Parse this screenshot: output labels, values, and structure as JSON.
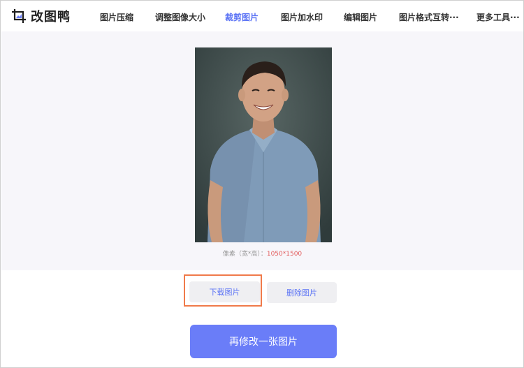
{
  "app": {
    "name": "改图鸭"
  },
  "nav": {
    "items": [
      {
        "label": "图片压缩",
        "active": false
      },
      {
        "label": "调整图像大小",
        "active": false
      },
      {
        "label": "裁剪图片",
        "active": true
      },
      {
        "label": "图片加水印",
        "active": false
      },
      {
        "label": "编辑图片",
        "active": false
      },
      {
        "label": "图片格式互转···",
        "active": false
      },
      {
        "label": "更多工具···",
        "active": false
      }
    ]
  },
  "preview": {
    "pixel_label": "像素（宽*高）：",
    "pixel_value": "1050*1500"
  },
  "actions": {
    "download": "下载图片",
    "delete": "删除图片",
    "again": "再修改一张图片"
  },
  "colors": {
    "accent": "#5b73f5",
    "primary_button": "#6a7df8",
    "highlight_border": "#f07a4a",
    "pixel_value": "#e25b5b"
  }
}
